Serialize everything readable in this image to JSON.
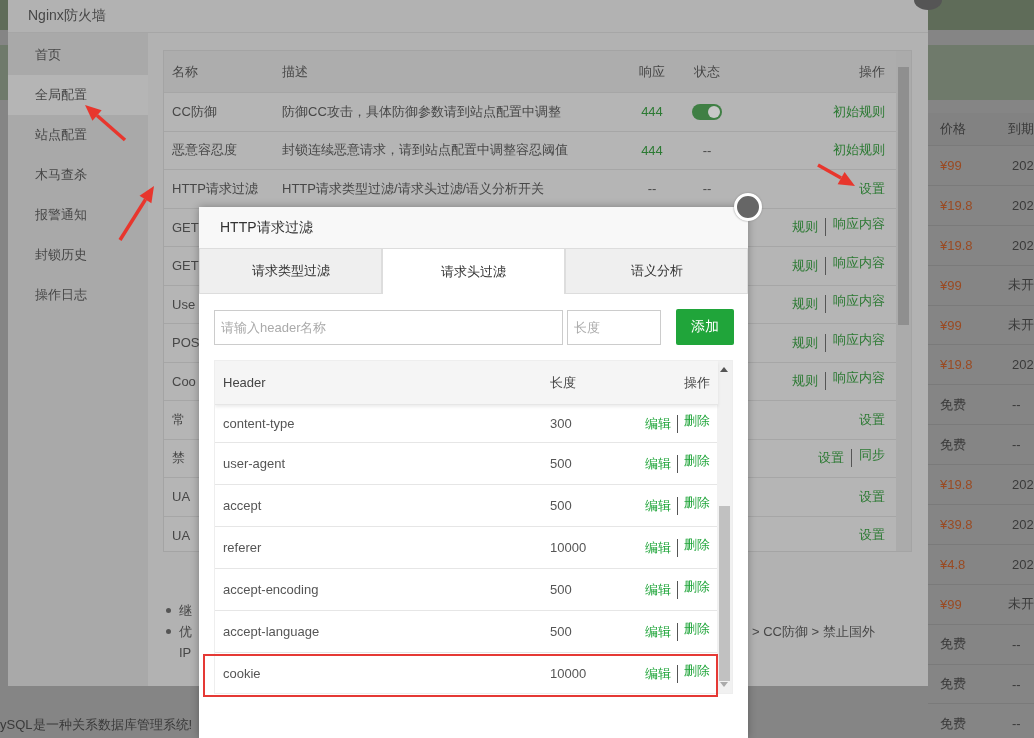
{
  "background_page": {
    "columns": [
      "价格",
      "到期"
    ],
    "rows": [
      {
        "price": "¥99",
        "kind": "paid",
        "expiry": "202"
      },
      {
        "price": "¥19.8",
        "kind": "paid",
        "expiry": "202"
      },
      {
        "price": "¥19.8",
        "kind": "paid",
        "expiry": "202"
      },
      {
        "price": "¥99",
        "kind": "paid",
        "expiry": "未开"
      },
      {
        "price": "¥99",
        "kind": "paid",
        "expiry": "未开"
      },
      {
        "price": "¥19.8",
        "kind": "paid",
        "expiry": "202"
      },
      {
        "price": "免费",
        "kind": "free",
        "expiry": "--"
      },
      {
        "price": "免费",
        "kind": "free",
        "expiry": "--"
      },
      {
        "price": "¥19.8",
        "kind": "paid",
        "expiry": "202"
      },
      {
        "price": "¥39.8",
        "kind": "paid",
        "expiry": "202"
      },
      {
        "price": "¥4.8",
        "kind": "paid",
        "expiry": "202"
      },
      {
        "price": "¥99",
        "kind": "paid",
        "expiry": "未开"
      },
      {
        "price": "免费",
        "kind": "free",
        "expiry": "--"
      },
      {
        "price": "免费",
        "kind": "free",
        "expiry": "--"
      },
      {
        "price": "免费",
        "kind": "free",
        "expiry": "--"
      }
    ],
    "footer_text": "ySQL是一种关系数据库管理系统!"
  },
  "firewall_window": {
    "title": "Nginx防火墙",
    "sidebar": {
      "items": [
        {
          "label": "首页",
          "selected": false
        },
        {
          "label": "全局配置",
          "selected": true
        },
        {
          "label": "站点配置",
          "selected": false
        },
        {
          "label": "木马查杀",
          "selected": false
        },
        {
          "label": "报警通知",
          "selected": false
        },
        {
          "label": "封锁历史",
          "selected": false
        },
        {
          "label": "操作日志",
          "selected": false
        }
      ]
    },
    "rules_table": {
      "columns": [
        "名称",
        "描述",
        "响应",
        "状态",
        "操作"
      ],
      "rows": [
        {
          "name": "CC防御",
          "description": "防御CC攻击，具体防御参数请到站点配置中调整",
          "response": "444",
          "status": {
            "kind": "toggle",
            "on": true
          },
          "actions": [
            "初始规则"
          ]
        },
        {
          "name": "恶意容忍度",
          "description": "封锁连续恶意请求，请到站点配置中调整容忍阈值",
          "response": "444",
          "status": {
            "kind": "text",
            "text": "--"
          },
          "actions": [
            "初始规则"
          ]
        },
        {
          "name": "HTTP请求过滤",
          "description": "HTTP请求类型过滤/请求头过滤/语义分析开关",
          "response": "--",
          "status": {
            "kind": "text",
            "text": "--"
          },
          "actions": [
            "设置"
          ]
        },
        {
          "name": "GET",
          "actions": [
            "规则",
            "响应内容"
          ]
        },
        {
          "name": "GET",
          "actions": [
            "规则",
            "响应内容"
          ]
        },
        {
          "name": "Use",
          "actions": [
            "规则",
            "响应内容"
          ]
        },
        {
          "name": "POS",
          "actions": [
            "规则",
            "响应内容"
          ]
        },
        {
          "name": "Coo",
          "actions": [
            "规则",
            "响应内容"
          ]
        },
        {
          "name": "常",
          "actions": [
            "设置"
          ]
        },
        {
          "name": "禁",
          "actions": [
            "设置",
            "同步"
          ]
        },
        {
          "name": "UA",
          "actions": [
            "设置"
          ]
        },
        {
          "name": "UA",
          "actions": [
            "设置"
          ]
        }
      ]
    },
    "notes": [
      {
        "text": "继"
      },
      {
        "text": "优",
        "tail": "> CC防御 > 禁止国外",
        "line2": "IP"
      }
    ]
  },
  "dialog": {
    "title": "HTTP请求过滤",
    "tabs": [
      {
        "label": "请求类型过滤",
        "selected": false
      },
      {
        "label": "请求头过滤",
        "selected": true
      },
      {
        "label": "语义分析",
        "selected": false
      }
    ],
    "name_field": {
      "placeholder": "请输入header名称"
    },
    "length_field": {
      "placeholder": "长度"
    },
    "add_button": "添加",
    "table": {
      "columns": [
        "Header",
        "长度",
        "操作"
      ],
      "rows": [
        {
          "header": "content-type",
          "length": "300",
          "actions": [
            "编辑",
            "删除"
          ],
          "highlighted": false
        },
        {
          "header": "user-agent",
          "length": "500",
          "actions": [
            "编辑",
            "删除"
          ],
          "highlighted": false
        },
        {
          "header": "accept",
          "length": "500",
          "actions": [
            "编辑",
            "删除"
          ],
          "highlighted": false
        },
        {
          "header": "referer",
          "length": "10000",
          "actions": [
            "编辑",
            "删除"
          ],
          "highlighted": false
        },
        {
          "header": "accept-encoding",
          "length": "500",
          "actions": [
            "编辑",
            "删除"
          ],
          "highlighted": false
        },
        {
          "header": "accept-language",
          "length": "500",
          "actions": [
            "编辑",
            "删除"
          ],
          "highlighted": false
        },
        {
          "header": "cookie",
          "length": "10000",
          "actions": [
            "编辑",
            "删除"
          ],
          "highlighted": true
        }
      ]
    }
  }
}
